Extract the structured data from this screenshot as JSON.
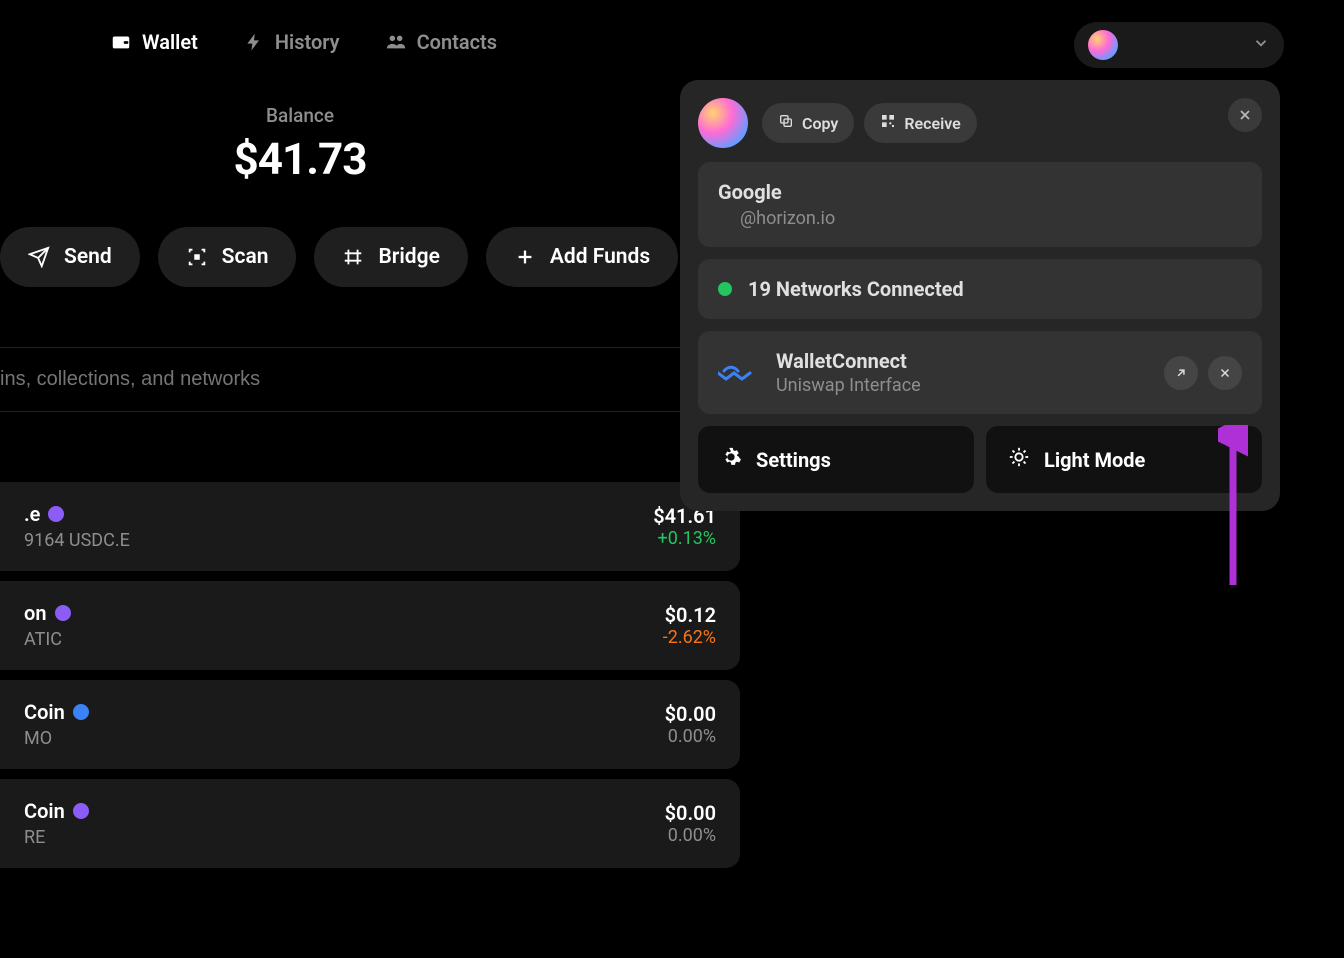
{
  "nav": {
    "wallet": "Wallet",
    "history": "History",
    "contacts": "Contacts"
  },
  "balance": {
    "label": "Balance",
    "value": "$41.73"
  },
  "actions": {
    "send": "Send",
    "scan": "Scan",
    "bridge": "Bridge",
    "add_funds": "Add Funds"
  },
  "search": {
    "placeholder": "ins, collections, and networks"
  },
  "tokens": [
    {
      "name": ".e",
      "sub": "9164 USDC.E",
      "amount": "$41.61",
      "change": "+0.13%",
      "dir": "pos",
      "badge": "purple"
    },
    {
      "name": "on",
      "sub": "ATIC",
      "amount": "$0.12",
      "change": "-2.62%",
      "dir": "neg",
      "badge": "purple"
    },
    {
      "name": "Coin",
      "sub": "MO",
      "amount": "$0.00",
      "change": "0.00%",
      "dir": "neu",
      "badge": "blue"
    },
    {
      "name": "Coin",
      "sub": "RE",
      "amount": "$0.00",
      "change": "0.00%",
      "dir": "neu",
      "badge": "purple"
    }
  ],
  "popover": {
    "copy": "Copy",
    "receive": "Receive",
    "google_title": "Google",
    "google_sub": "@horizon.io",
    "networks": "19 Networks Connected",
    "wc_title": "WalletConnect",
    "wc_sub": "Uniswap Interface",
    "settings": "Settings",
    "light_mode": "Light Mode"
  }
}
